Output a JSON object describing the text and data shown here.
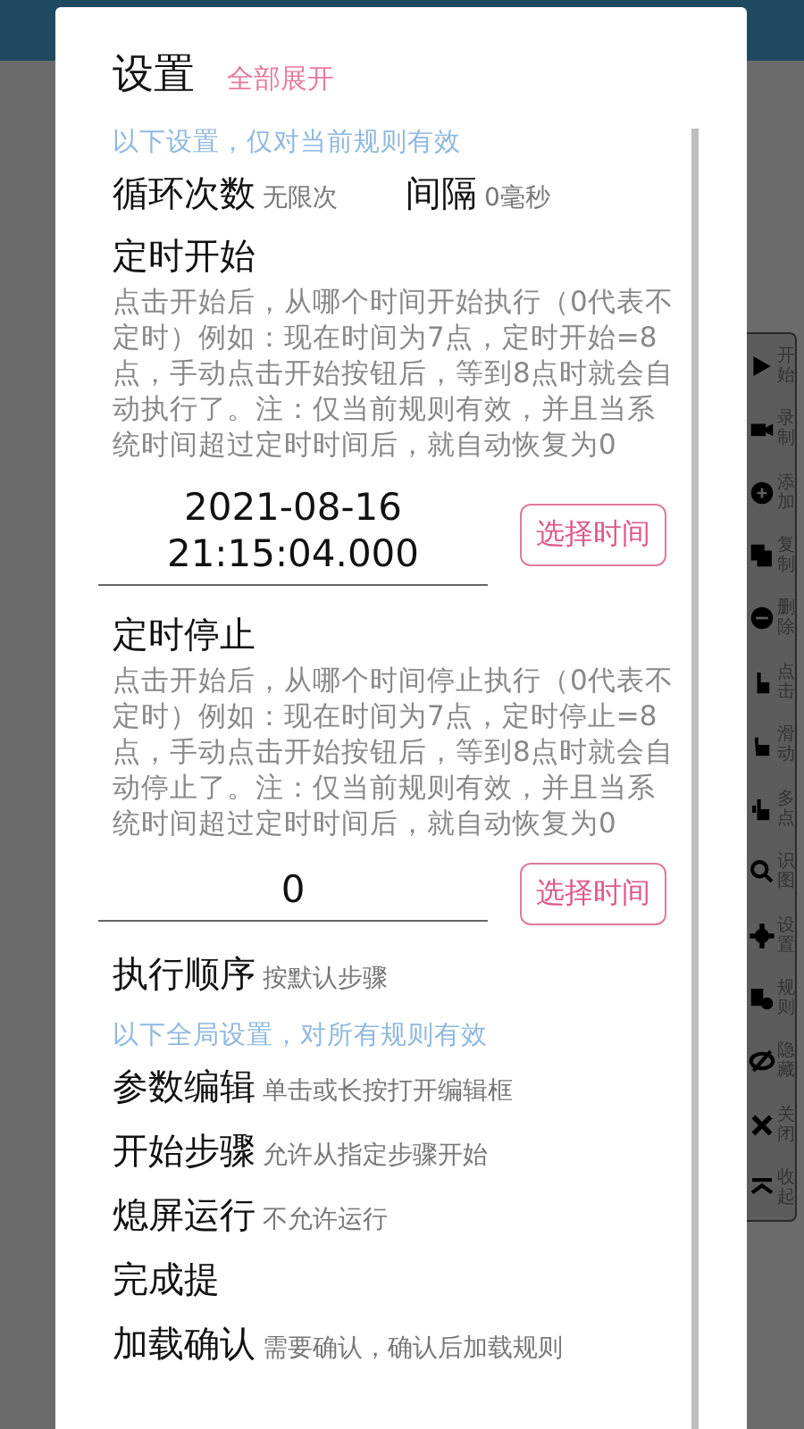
{
  "dialog": {
    "title": "设置",
    "expand_link": "全部展开",
    "items": [
      {
        "kind": "note",
        "text": "以下设置，仅对当前规则有效"
      },
      {
        "kind": "pair",
        "entries": [
          {
            "label": "循环次数",
            "value": "无限次"
          },
          {
            "label": "间隔",
            "value": "0毫秒"
          }
        ]
      },
      {
        "kind": "timer",
        "label": "定时开始",
        "description": "点击开始后，从哪个时间开始执行（0代表不定时）例如：现在时间为7点，定时开始=8点，手动点击开始按钮后，等到8点时就会自动执行了。注：仅当前规则有效，并且当系统时间超过定时时间后，就自动恢复为0",
        "value_lines": [
          "2021-08-16",
          "21:15:04.000"
        ],
        "button": "选择时间"
      },
      {
        "kind": "timer",
        "label": "定时停止",
        "description": "点击开始后，从哪个时间停止执行（0代表不定时）例如：现在时间为7点，定时停止=8点，手动点击开始按钮后，等到8点时就会自动停止了。注：仅当前规则有效，并且当系统时间超过定时时间后，就自动恢复为0",
        "value_lines": [
          "0"
        ],
        "button": "选择时间"
      },
      {
        "kind": "setting",
        "label": "执行顺序",
        "value": "按默认步骤"
      },
      {
        "kind": "note",
        "text": "以下全局设置，对所有规则有效"
      },
      {
        "kind": "setting",
        "label": "参数编辑",
        "value": "单击或长按打开编辑框"
      },
      {
        "kind": "setting",
        "label": "开始步骤",
        "value": "允许从指定步骤开始"
      },
      {
        "kind": "setting",
        "label": "熄屏运行",
        "value": "不允许运行"
      },
      {
        "kind": "setting",
        "label": "完成提"
      },
      {
        "kind": "setting",
        "label": "加载确认",
        "value": "需要确认，确认后加载规则"
      }
    ]
  },
  "toolbar": [
    {
      "label": "开始"
    },
    {
      "label": "录制"
    },
    {
      "label": "添加"
    },
    {
      "label": "复制"
    },
    {
      "label": "删除"
    },
    {
      "label": "点击"
    },
    {
      "label": "滑动"
    },
    {
      "label": "多点"
    },
    {
      "label": "识图"
    },
    {
      "label": "设置"
    },
    {
      "label": "规则"
    },
    {
      "label": "隐藏"
    },
    {
      "label": "关闭"
    },
    {
      "label": "收起"
    }
  ]
}
